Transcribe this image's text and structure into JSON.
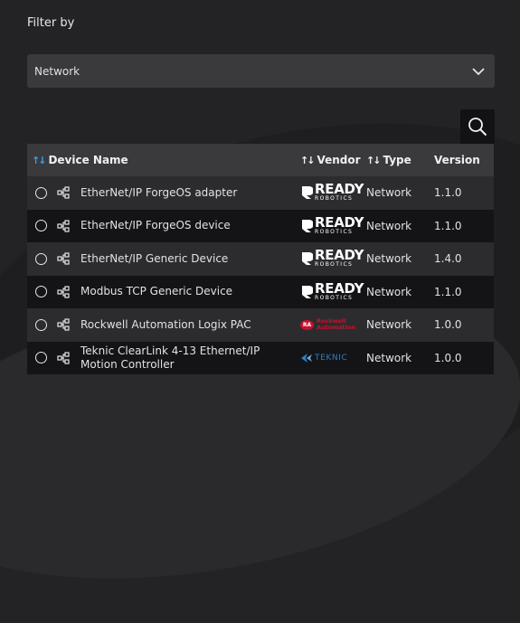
{
  "filter": {
    "label": "Filter by",
    "selected": "Network"
  },
  "table": {
    "headers": {
      "device_name": "Device Name",
      "vendor": "Vendor",
      "type": "Type",
      "version": "Version"
    },
    "rows": [
      {
        "name": "EtherNet/IP ForgeOS adapter",
        "vendor_logo": "ready-robotics-logo",
        "type": "Network",
        "version": "1.1.0"
      },
      {
        "name": "EtherNet/IP ForgeOS device",
        "vendor_logo": "ready-robotics-logo",
        "type": "Network",
        "version": "1.1.0"
      },
      {
        "name": "EtherNet/IP Generic Device",
        "vendor_logo": "ready-robotics-logo",
        "type": "Network",
        "version": "1.4.0"
      },
      {
        "name": "Modbus TCP Generic Device",
        "vendor_logo": "ready-robotics-logo",
        "type": "Network",
        "version": "1.1.0"
      },
      {
        "name": "Rockwell Automation Logix PAC",
        "vendor_logo": "rockwell-automation-logo",
        "type": "Network",
        "version": "1.0.0"
      },
      {
        "name": "Teknic ClearLink 4-13 Ethernet/IP Motion Controller",
        "vendor_logo": "teknic-logo",
        "type": "Network",
        "version": "1.0.0"
      }
    ]
  },
  "logos": {
    "ready": {
      "word": "READY",
      "sub": "ROBOTICS"
    },
    "rockwell": {
      "badge": "RA",
      "line1": "Rockwell",
      "line2": "Automation"
    },
    "teknic": {
      "word": "TEKNIC"
    }
  },
  "colors": {
    "background": "#232326",
    "header_row": "#3a3a3d",
    "row_odd": "#2c2c2f",
    "row_even": "#141416",
    "sort_active": "#3aa0e6",
    "rockwell_red": "#c8102e",
    "teknic_blue": "#2b7fc8"
  },
  "icons": {
    "dropdown": "chevron-down-icon",
    "search": "search-icon",
    "row_type": "network-icon",
    "sort": "sort-arrows-icon"
  }
}
